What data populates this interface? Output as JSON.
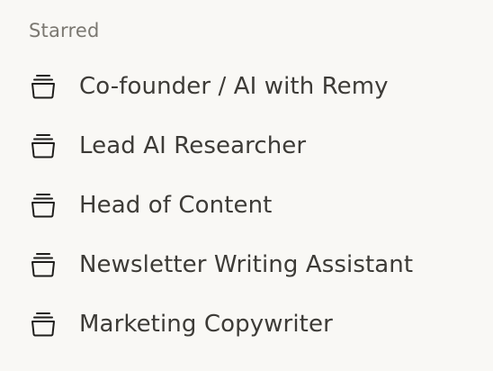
{
  "sidebar": {
    "section_title": "Starred",
    "items": [
      {
        "label": "Co-founder / AI with Remy",
        "icon": "project-stack-icon"
      },
      {
        "label": "Lead AI Researcher",
        "icon": "project-stack-icon"
      },
      {
        "label": "Head of Content",
        "icon": "project-stack-icon"
      },
      {
        "label": "Newsletter Writing Assistant",
        "icon": "project-stack-icon"
      },
      {
        "label": "Marketing Copywriter",
        "icon": "project-stack-icon"
      }
    ]
  },
  "colors": {
    "background": "#f9f8f5",
    "text": "#3d3b37",
    "muted_text": "#7b7871"
  }
}
